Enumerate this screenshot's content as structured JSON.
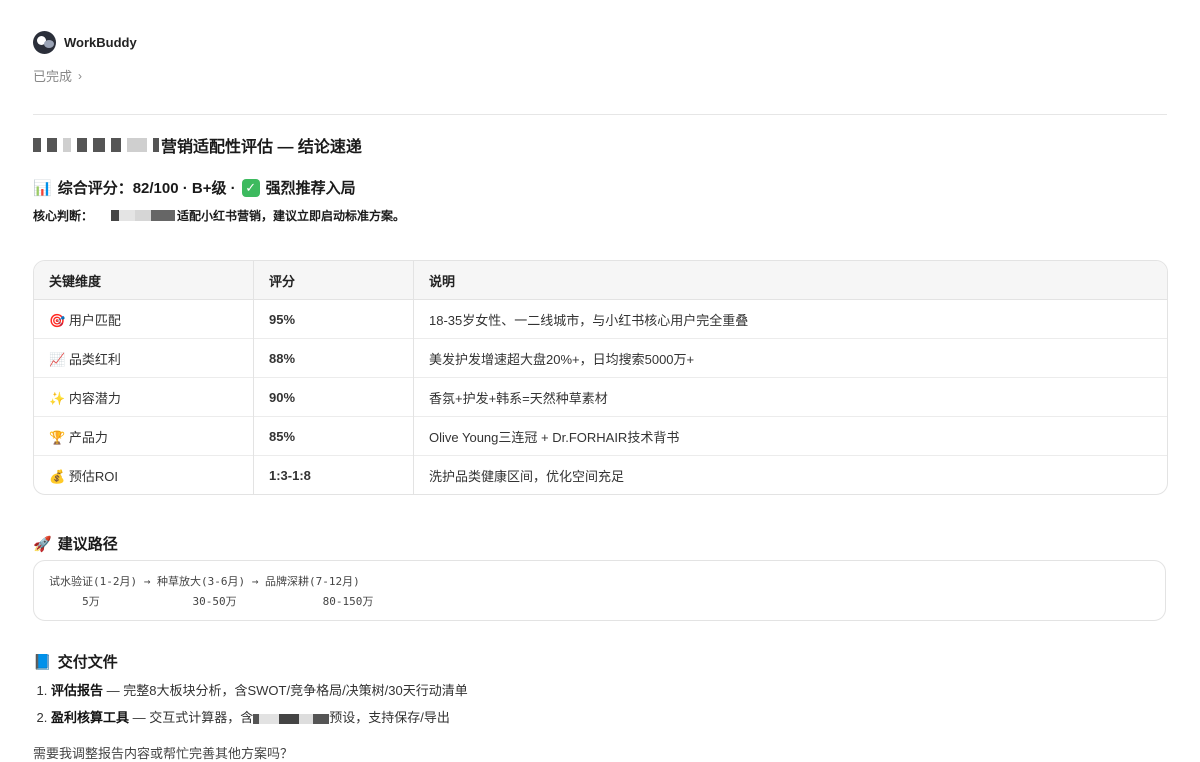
{
  "app": {
    "name": "WorkBuddy",
    "status": "已完成"
  },
  "title": "营销适配性评估 — 结论速递",
  "score_line": {
    "prefix": "综合评分：82/100 · B+级 · ",
    "highlight": "强烈推荐入局"
  },
  "core": {
    "label": "核心判断：",
    "text": "适配小红书营销，建议立即启动标准方案。"
  },
  "table": {
    "headers": [
      "关键维度",
      "评分",
      "说明"
    ],
    "rows": [
      {
        "icon": "🎯",
        "dim": "用户匹配",
        "score": "95%",
        "desc": "18-35岁女性、一二线城市，与小红书核心用户完全重叠"
      },
      {
        "icon": "📈",
        "dim": "品类红利",
        "score": "88%",
        "desc": "美发护发增速超大盘20%+，日均搜索5000万+"
      },
      {
        "icon": "✨",
        "dim": "内容潜力",
        "score": "90%",
        "desc": "香氛+护发+韩系=天然种草素材"
      },
      {
        "icon": "🏆",
        "dim": "产品力",
        "score": "85%",
        "desc": "Olive Young三连冠 + Dr.FORHAIR技术背书"
      },
      {
        "icon": "💰",
        "dim": "预估ROI",
        "score": "1:3-1:8",
        "desc": "洗护品类健康区间，优化空间充足"
      }
    ]
  },
  "path": {
    "heading": "建议路径",
    "line1": "试水验证(1-2月) → 种草放大(3-6月) → 品牌深耕(7-12月)",
    "line2": "     5万              30-50万             80-150万"
  },
  "deliverables": {
    "heading": "交付文件",
    "items": [
      {
        "name": "评估报告",
        "desc": " — 完整8大板块分析，含SWOT/竞争格局/决策树/30天行动清单"
      },
      {
        "name": "盈利核算工具",
        "desc_a": " — 交互式计算器，含",
        "desc_b": "预设，支持保存/导出"
      }
    ]
  },
  "footer_cut": "需要我调整报告内容或帮忙完善其他方案吗？"
}
